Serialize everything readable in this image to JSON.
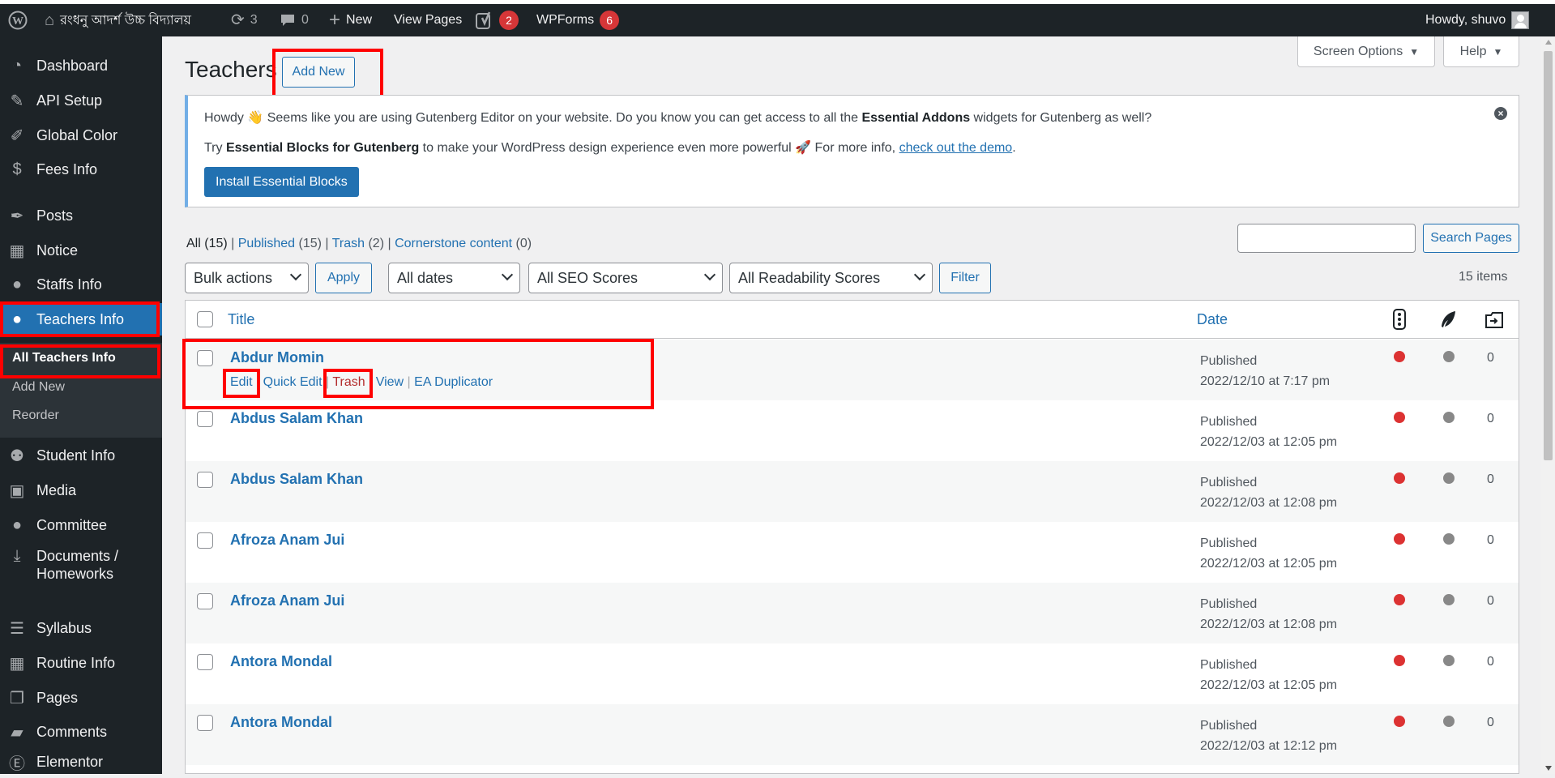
{
  "admin_bar": {
    "site_name": "রংধনু আদর্শ উচ্চ বিদ্যালয়",
    "updates_count": "3",
    "comments_count": "0",
    "new_label": "New",
    "view_pages_label": "View Pages",
    "yoast_badge": "2",
    "wpforms_label": "WPForms",
    "wpforms_badge": "6",
    "howdy": "Howdy, shuvo"
  },
  "sidebar": {
    "items": [
      {
        "label": "Dashboard",
        "icon": "dashboard-icon"
      },
      {
        "label": "API Setup",
        "icon": "tools-icon"
      },
      {
        "label": "Global Color",
        "icon": "brush-icon"
      },
      {
        "label": "Fees Info",
        "icon": "dollar-icon"
      },
      {
        "label": "Posts",
        "icon": "pin-icon"
      },
      {
        "label": "Notice",
        "icon": "calendar-icon"
      },
      {
        "label": "Staffs Info",
        "icon": "user-icon"
      },
      {
        "label": "Teachers Info",
        "icon": "user-icon"
      },
      {
        "label": "Student Info",
        "icon": "groups-icon"
      },
      {
        "label": "Media",
        "icon": "media-icon"
      },
      {
        "label": "Committee",
        "icon": "user-icon"
      },
      {
        "label": "Documents / Homeworks",
        "label_line1": "Documents /",
        "label_line2": "Homeworks",
        "icon": "download-icon"
      },
      {
        "label": "Syllabus",
        "icon": "list-icon"
      },
      {
        "label": "Routine Info",
        "icon": "calendar-icon"
      },
      {
        "label": "Pages",
        "icon": "pages-icon"
      },
      {
        "label": "Comments",
        "icon": "comment-icon"
      },
      {
        "label": "Elementor",
        "icon": "elementor-icon"
      }
    ],
    "submenu": [
      "All Teachers Info",
      "Add New",
      "Reorder"
    ]
  },
  "page": {
    "title": "Teachers",
    "add_new": "Add New",
    "screen_options": "Screen Options",
    "help": "Help"
  },
  "notice": {
    "line1_a": "Howdy 👋 Seems like you are using Gutenberg Editor on your website. Do you know you can get access to all the ",
    "line1_bold": "Essential Addons",
    "line1_b": " widgets for Gutenberg as well?",
    "line2_a": "Try ",
    "line2_bold": "Essential Blocks for Gutenberg",
    "line2_b": " to make your WordPress design experience even more powerful 🚀 For more info, ",
    "line2_link": "check out the demo",
    "line2_c": ".",
    "button": "Install Essential Blocks"
  },
  "views": {
    "all": "All",
    "all_count": "(15)",
    "published": "Published",
    "published_count": "(15)",
    "trash": "Trash",
    "trash_count": "(2)",
    "cornerstone": "Cornerstone content",
    "cornerstone_count": "(0)"
  },
  "search_button": "Search Pages",
  "filters": {
    "bulk": "Bulk actions",
    "apply": "Apply",
    "dates": "All dates",
    "seo": "All SEO Scores",
    "readability": "All Readability Scores",
    "filter": "Filter",
    "items_count": "15 items"
  },
  "table": {
    "col_title": "Title",
    "col_date": "Date",
    "actions": {
      "edit": "Edit",
      "quick_edit": "Quick Edit",
      "trash": "Trash",
      "view": "View",
      "duplicator": "EA Duplicator",
      "sep": "|"
    },
    "rows": [
      {
        "title": "Abdur Momin",
        "status": "Published",
        "date": "2022/12/10 at 7:17 pm",
        "count": "0"
      },
      {
        "title": "Abdus Salam Khan",
        "status": "Published",
        "date": "2022/12/03 at 12:05 pm",
        "count": "0"
      },
      {
        "title": "Abdus Salam Khan",
        "status": "Published",
        "date": "2022/12/03 at 12:08 pm",
        "count": "0"
      },
      {
        "title": "Afroza Anam Jui",
        "status": "Published",
        "date": "2022/12/03 at 12:05 pm",
        "count": "0"
      },
      {
        "title": "Afroza Anam Jui",
        "status": "Published",
        "date": "2022/12/03 at 12:08 pm",
        "count": "0"
      },
      {
        "title": "Antora Mondal",
        "status": "Published",
        "date": "2022/12/03 at 12:05 pm",
        "count": "0"
      },
      {
        "title": "Antora Mondal",
        "status": "Published",
        "date": "2022/12/03 at 12:12 pm",
        "count": "0"
      }
    ]
  },
  "colors": {
    "admin_bar": "#1d2327",
    "accent": "#2271b1",
    "highlight_box": "#ff0000",
    "seo_dot": "#dc3232",
    "readability_dot": "#888888"
  }
}
